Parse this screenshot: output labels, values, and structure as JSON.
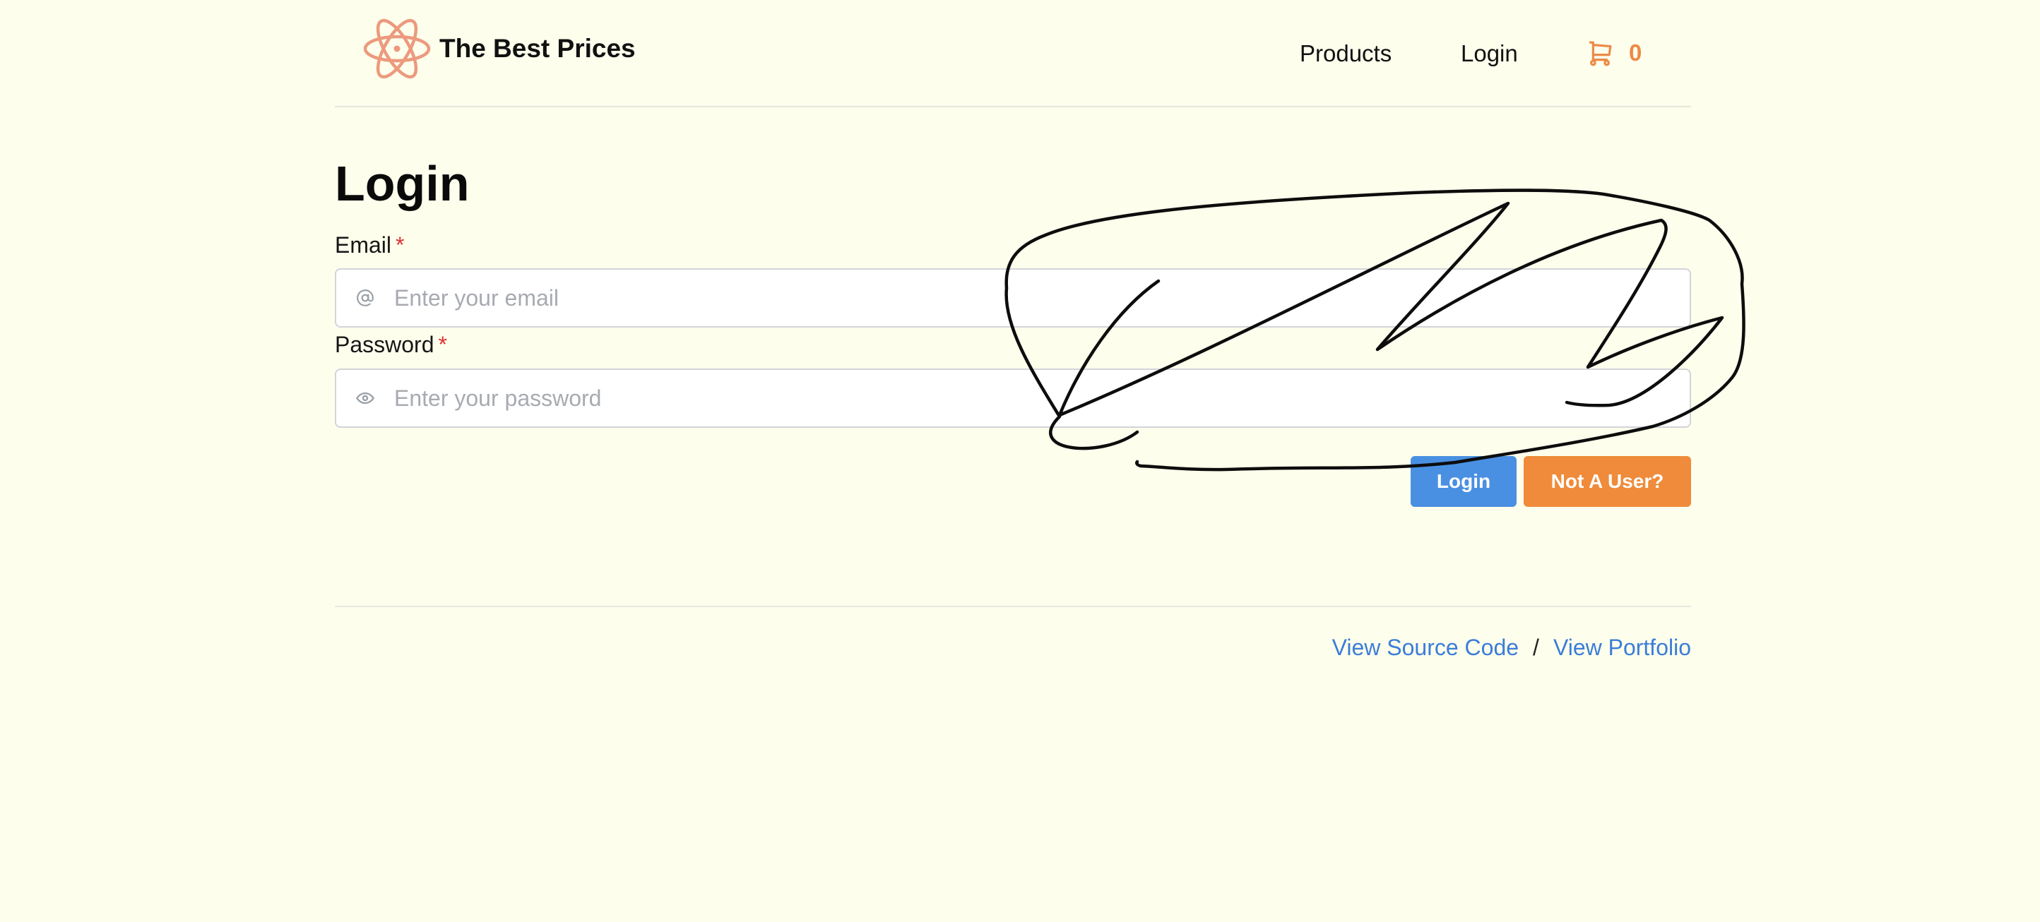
{
  "header": {
    "brand_name": "The Best Prices",
    "nav": {
      "products": "Products",
      "login": "Login"
    },
    "cart": {
      "icon": "shopping-cart-icon",
      "count": "0"
    }
  },
  "main": {
    "title": "Login",
    "email": {
      "label": "Email",
      "required_mark": "*",
      "placeholder": "Enter your email",
      "value": "",
      "icon": "at-sign-icon"
    },
    "password": {
      "label": "Password",
      "required_mark": "*",
      "placeholder": "Enter your password",
      "value": "",
      "icon": "eye-icon"
    },
    "buttons": {
      "login": "Login",
      "register": "Not A User?"
    }
  },
  "footer": {
    "source_link": "View Source Code",
    "separator": "/",
    "portfolio_link": "View Portfolio"
  },
  "colors": {
    "background": "#fdfeec",
    "accent_orange": "#ef8b3a",
    "accent_blue": "#4a90e2",
    "link_blue": "#3b7dd8",
    "required_red": "#e03131",
    "logo_color": "#ec9a7e"
  }
}
